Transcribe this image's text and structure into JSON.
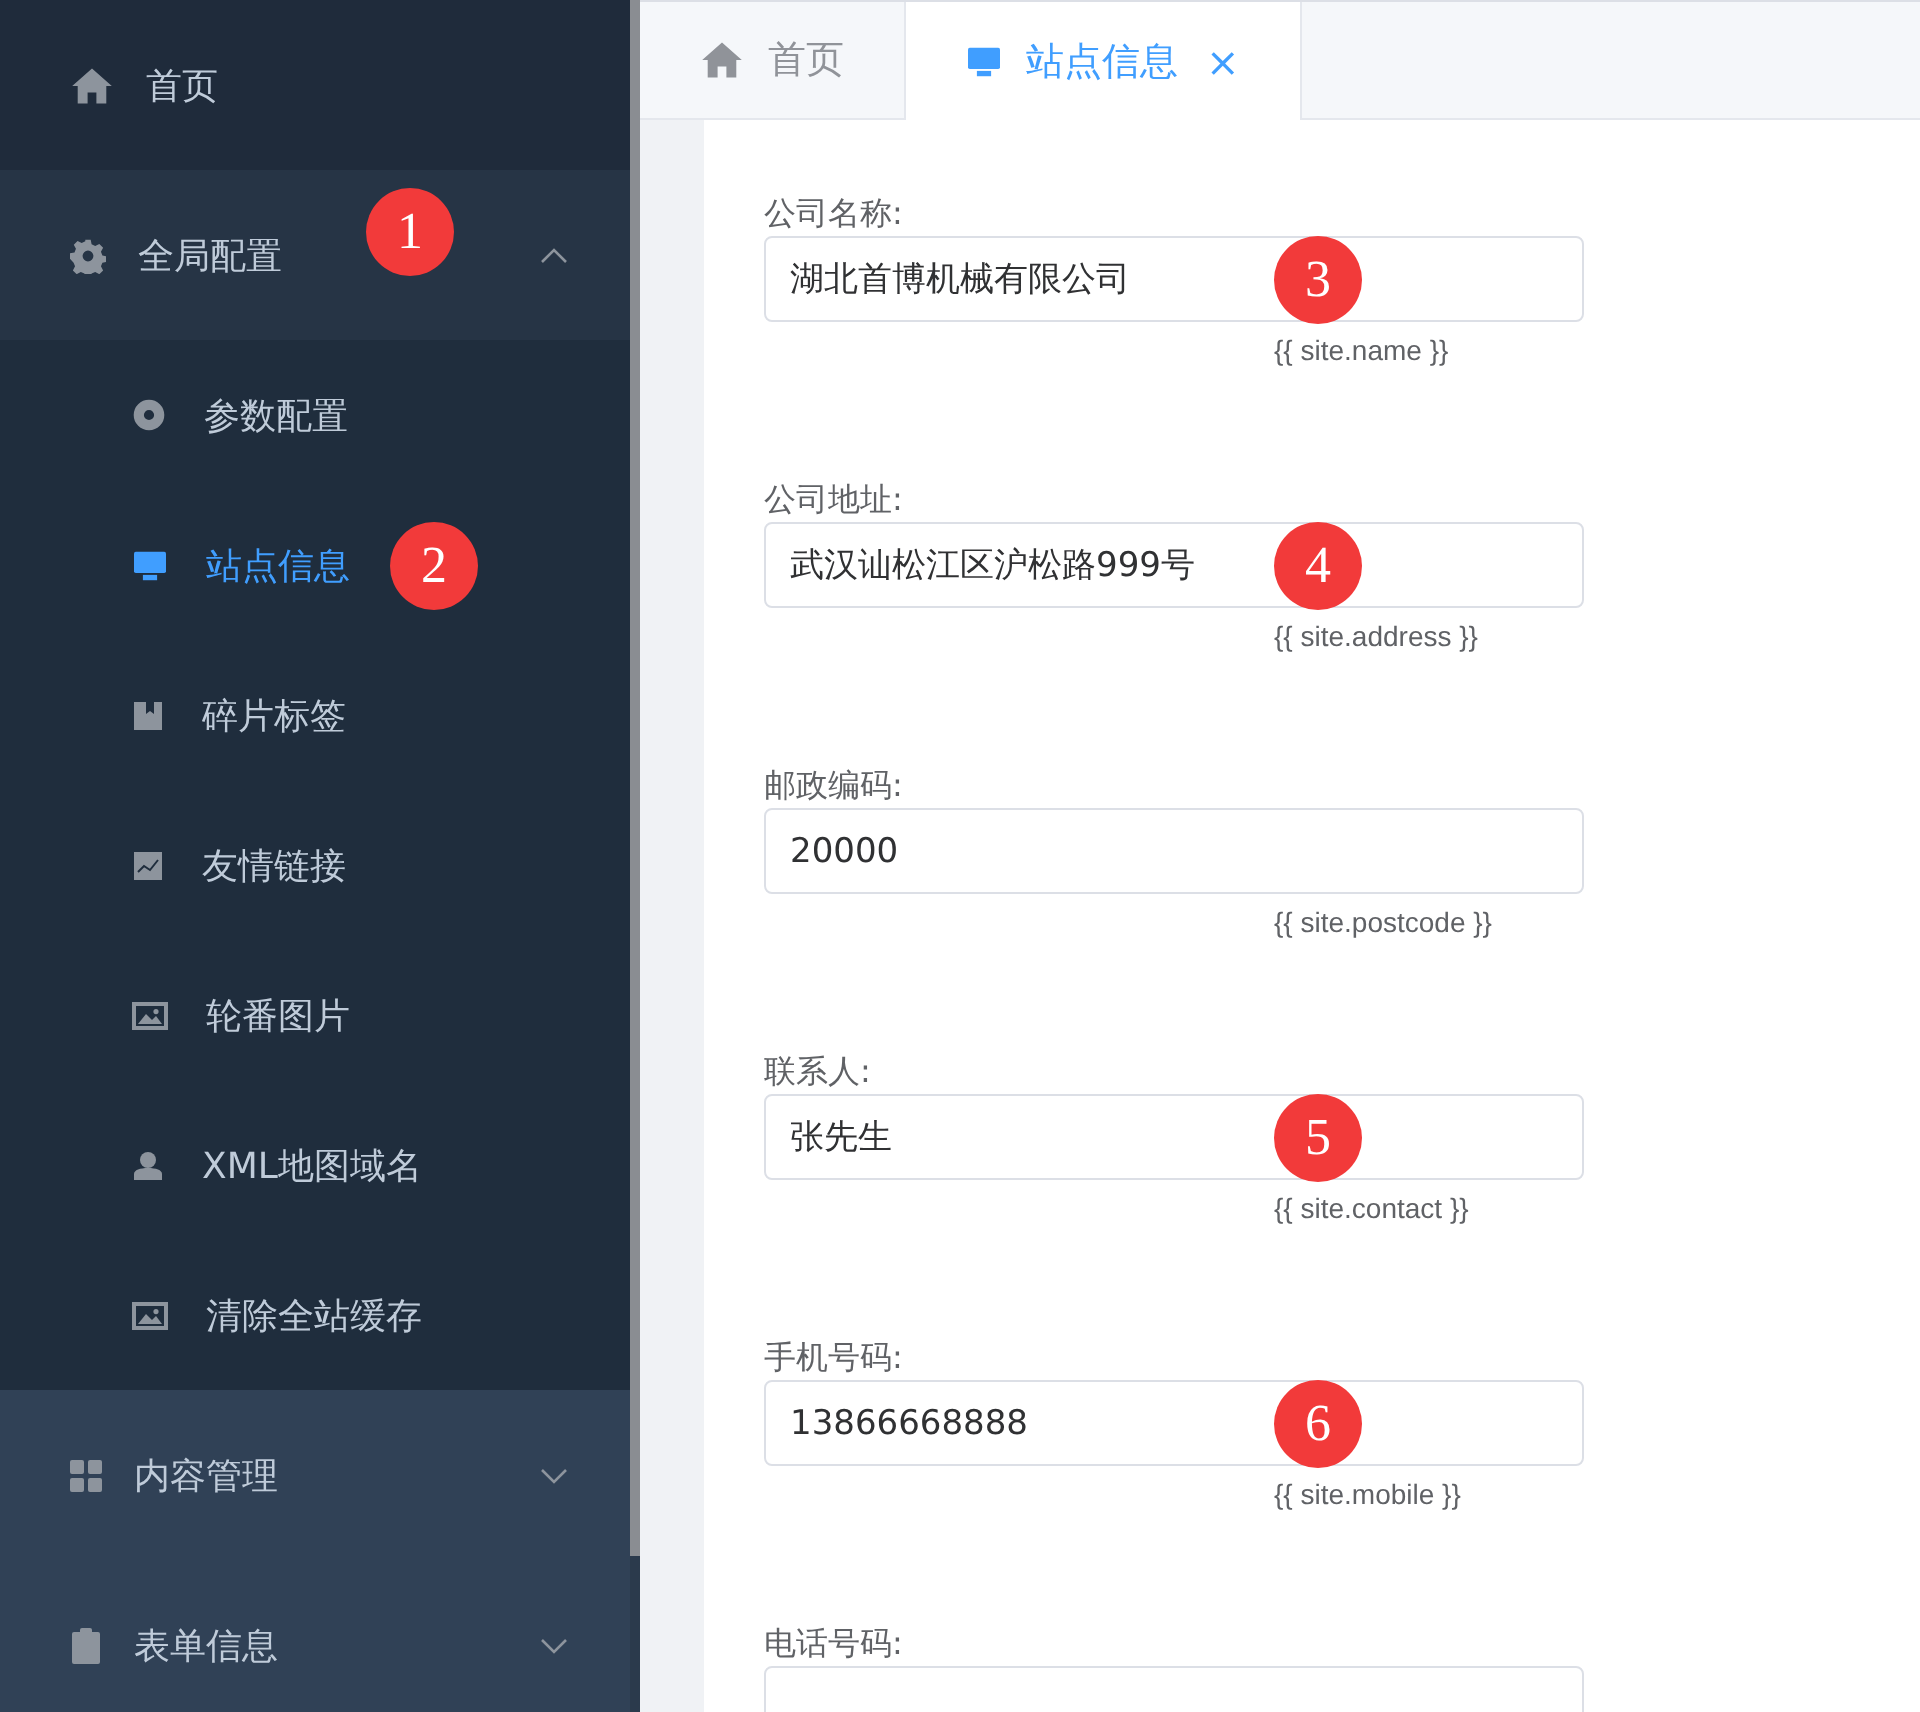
{
  "sidebar": {
    "items": [
      {
        "label": "首页",
        "kind": "home",
        "selected": false
      },
      {
        "label": "全局配置",
        "kind": "gear",
        "selected": false,
        "expanded": true,
        "marker": "1",
        "children": [
          {
            "label": "参数配置",
            "kind": "disc",
            "selected": false
          },
          {
            "label": "站点信息",
            "kind": "monitor",
            "selected": true,
            "marker": "2"
          },
          {
            "label": "碎片标签",
            "kind": "bookmark",
            "selected": false
          },
          {
            "label": "友情链接",
            "kind": "chart",
            "selected": false
          },
          {
            "label": "轮番图片",
            "kind": "image",
            "selected": false
          },
          {
            "label": "XML地图域名",
            "kind": "user",
            "selected": false
          },
          {
            "label": "清除全站缓存",
            "kind": "image",
            "selected": false
          }
        ]
      },
      {
        "label": "内容管理",
        "kind": "grid",
        "selected": false,
        "expanded": false
      },
      {
        "label": "表单信息",
        "kind": "clipboard",
        "selected": false,
        "expanded": false
      }
    ]
  },
  "tabs": [
    {
      "label": "首页",
      "kind": "home",
      "selected": false
    },
    {
      "label": "站点信息",
      "kind": "monitor",
      "selected": true,
      "close": "×"
    }
  ],
  "form": {
    "fields": [
      {
        "label": "公司名称:",
        "value": "湖北首博机械有限公司",
        "hint": "{{ site.name }}",
        "marker": "3"
      },
      {
        "label": "公司地址:",
        "value": "武汉讪松江区沪松路999号",
        "hint": "{{ site.address }}",
        "marker": "4"
      },
      {
        "label": "邮政编码:",
        "value": "20000",
        "hint": "{{ site.postcode }}"
      },
      {
        "label": "联系人:",
        "value": "张先生",
        "hint": "{{ site.contact }}",
        "marker": "5"
      },
      {
        "label": "手机号码:",
        "value": "13866668888",
        "hint": "{{ site.mobile }}",
        "marker": "6"
      },
      {
        "label": "电话号码:"
      }
    ]
  }
}
